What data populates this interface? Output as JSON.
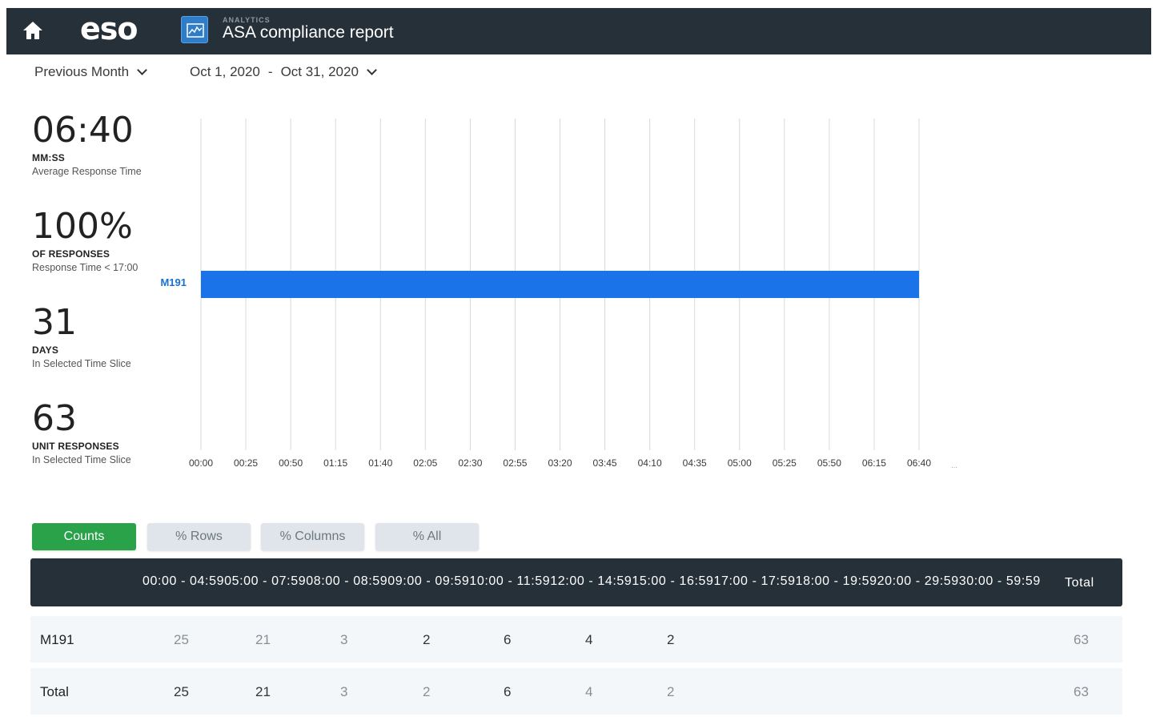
{
  "header": {
    "kicker": "ANALYTICS",
    "title": "ASA compliance report",
    "logo": "eso",
    "home_icon": "home-icon",
    "app_icon": "analytics-chart-icon",
    "bg_color": "#263038"
  },
  "filters": {
    "period": "Previous Month",
    "date_start": "Oct 1, 2020",
    "date_separator": "-",
    "date_end": "Oct 31, 2020"
  },
  "stats": [
    {
      "value": "06:40",
      "unit": "MM:SS",
      "desc": "Average Response Time"
    },
    {
      "value": "100%",
      "unit": "OF RESPONSES",
      "desc": "Response Time < 17:00"
    },
    {
      "value": "31",
      "unit": "DAYS",
      "desc": "In Selected Time Slice"
    },
    {
      "value": "63",
      "unit": "UNIT RESPONSES",
      "desc": "In Selected Time Slice"
    }
  ],
  "chart_data": {
    "type": "bar",
    "orientation": "horizontal",
    "categories": [
      "M191"
    ],
    "series": [
      {
        "values": [
          "06:40"
        ]
      }
    ],
    "x_tick_labels": [
      "00:00",
      "00:25",
      "00:50",
      "01:15",
      "01:40",
      "02:05",
      "02:30",
      "02:55",
      "03:20",
      "03:45",
      "04:10",
      "04:35",
      "05:00",
      "05:25",
      "05:50",
      "06:15",
      "06:40"
    ],
    "x_overflow_label": "...",
    "xlim_seconds": [
      0,
      400
    ],
    "bar_seconds": [
      400
    ],
    "grid": true,
    "bar_color": "#1a73e8"
  },
  "tabs": [
    {
      "label": "Counts",
      "active": true
    },
    {
      "label": "% Rows",
      "active": false
    },
    {
      "label": "% Columns",
      "active": false
    },
    {
      "label": "% All",
      "active": false
    }
  ],
  "table": {
    "header_text": "00:00 - 04:5905:00 - 07:5908:00 - 08:5909:00 - 09:5910:00 - 11:5912:00 - 14:5915:00 - 16:5917:00 - 17:5918:00 - 19:5920:00 - 29:5930:00 - 59:59",
    "total_header": "Total",
    "rows": [
      {
        "label": "M191",
        "values": [
          "25",
          "21",
          "3",
          "2",
          "6",
          "4",
          "2"
        ],
        "total": "63"
      },
      {
        "label": "Total",
        "values": [
          "25",
          "21",
          "3",
          "2",
          "6",
          "4",
          "2"
        ],
        "total": "63"
      }
    ]
  }
}
